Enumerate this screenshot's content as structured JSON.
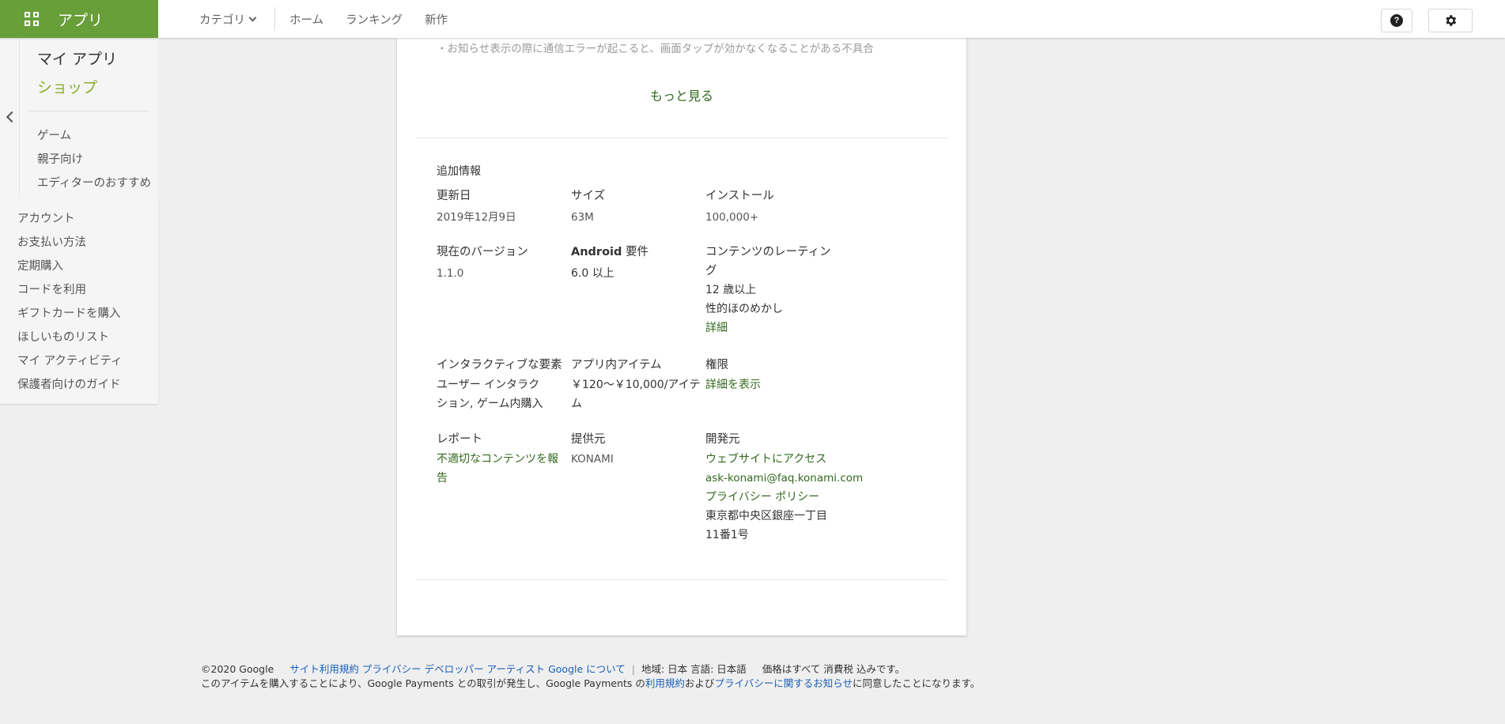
{
  "topbar": {
    "apps_label": "アプリ",
    "category_label": "カテゴリ",
    "nav_links": [
      "ホーム",
      "ランキング",
      "新作"
    ],
    "help_icon": "question-mark-circle-icon",
    "settings_icon": "gear-icon"
  },
  "sidebar": {
    "my_apps": "マイ アプリ",
    "shop": "ショップ",
    "sub_items": [
      "ゲーム",
      "親子向け",
      "エディターのおすすめ"
    ],
    "account_items": [
      "アカウント",
      "お支払い方法",
      "定期購入",
      "コードを利用",
      "ギフトカードを購入",
      "ほしいものリスト",
      "マイ アクティビティ",
      "保護者向けのガイド"
    ]
  },
  "details": {
    "changelog_line": "・お知らせ表示の際に通信エラーが起こると、画面タップが効かなくなることがある不具合",
    "more_label": "もっと見る",
    "section_title": "追加情報",
    "updated_label": "更新日",
    "updated_value": "2019年12月9日",
    "size_label": "サイズ",
    "size_value": "63M",
    "installs_label": "インストール",
    "installs_value": "100,000+",
    "version_label": "現在のバージョン",
    "version_value": "1.1.0",
    "android_label_bold": "Android",
    "android_label_rest": " 要件",
    "android_value": "6.0 以上",
    "rating_label_1": "コンテンツのレーティン",
    "rating_label_2": "グ",
    "rating_value_1": "12 歳以上",
    "rating_value_2": "性的ほのめかし",
    "rating_link": "詳細",
    "interactive_label": "インタラクティブな要素",
    "interactive_value_1": "ユーザー インタラク",
    "interactive_value_2": "ション, ゲーム内購入",
    "iap_label": "アプリ内アイテム",
    "iap_value_1": "￥120～￥10,000/アイテ",
    "iap_value_2": "ム",
    "permissions_label": "権限",
    "permissions_link": "詳細を表示",
    "report_label": "レポート",
    "report_link_1": "不適切なコンテンツを報",
    "report_link_2": "告",
    "provider_label": "提供元",
    "provider_value": "KONAMI",
    "developer_label": "開発元",
    "developer_site": "ウェブサイトにアクセス",
    "developer_email": "ask-konami@faq.konami.com",
    "developer_privacy": "プライバシー ポリシー",
    "developer_address_1": "東京都中央区銀座一丁目",
    "developer_address_2": "11番1号"
  },
  "footer": {
    "copyright": "©2020 Google",
    "links": [
      "サイト利用規約",
      "プライバシー",
      "デベロッパー",
      "アーティスト",
      "Google について"
    ],
    "region_text": "地域: 日本 言語: 日本語",
    "tax_text": "価格はすべて 消費税 込みです。",
    "line2_a": "このアイテムを購入することにより、Google Payments との取引が発生し、Google Payments の",
    "line2_terms": "利用規約",
    "line2_b": "および",
    "line2_privacy": "プライバシーに関するお知らせ",
    "line2_c": "に同意したことになります。"
  },
  "colors": {
    "apps_green": "#689f38",
    "shop_green": "#8bad2c",
    "link_green": "#33691e",
    "footer_link_blue": "#1a5fb4"
  }
}
